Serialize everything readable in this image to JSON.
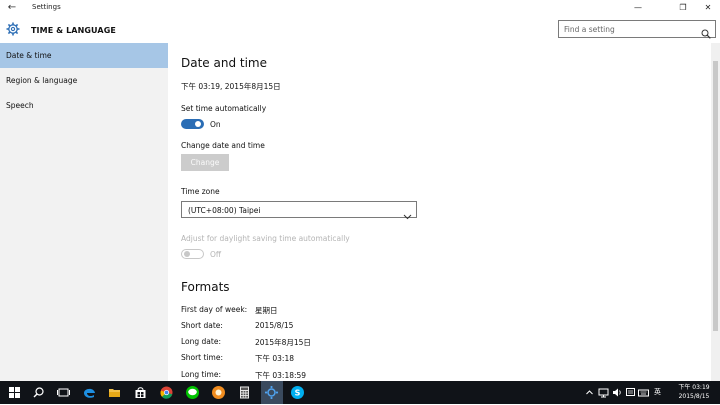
{
  "window": {
    "title": "Settings",
    "back_glyph": "←",
    "minimize_glyph": "—",
    "restore_glyph": "❐",
    "close_glyph": "✕"
  },
  "header": {
    "title": "TIME & LANGUAGE",
    "search_placeholder": "Find a setting"
  },
  "sidebar": {
    "items": [
      {
        "label": "Date & time",
        "active": true
      },
      {
        "label": "Region & language",
        "active": false
      },
      {
        "label": "Speech",
        "active": false
      }
    ]
  },
  "main": {
    "section_title": "Date and time",
    "current_datetime": "下午 03:19, 2015年8月15日",
    "set_time_auto": {
      "label": "Set time automatically",
      "state": "On"
    },
    "change_datetime": {
      "label": "Change date and time",
      "button": "Change"
    },
    "time_zone": {
      "label": "Time zone",
      "value": "(UTC+08:00) Taipei"
    },
    "daylight": {
      "label": "Adjust for daylight saving time automatically",
      "state": "Off"
    },
    "formats": {
      "title": "Formats",
      "rows": [
        {
          "key": "First day of week:",
          "value": "星期日"
        },
        {
          "key": "Short date:",
          "value": "2015/8/15"
        },
        {
          "key": "Long date:",
          "value": "2015年8月15日"
        },
        {
          "key": "Short time:",
          "value": "下午 03:18"
        },
        {
          "key": "Long time:",
          "value": "下午 03:18:59"
        }
      ]
    }
  },
  "taskbar": {
    "icons": [
      "windows-start-icon",
      "search-icon",
      "task-view-icon",
      "edge-icon",
      "file-explorer-icon",
      "store-icon",
      "chrome-icon",
      "line-icon",
      "weather-app-icon",
      "calculator-icon",
      "settings-icon",
      "skype-icon"
    ],
    "tray_lang": "英",
    "clock_time": "下午 03:19",
    "clock_date": "2015/8/15"
  },
  "colors": {
    "accent": "#2a6db5",
    "sidebar_bg": "#f2f2f2",
    "sidebar_active": "#a6c6e6",
    "taskbar_bg": "#101318"
  }
}
